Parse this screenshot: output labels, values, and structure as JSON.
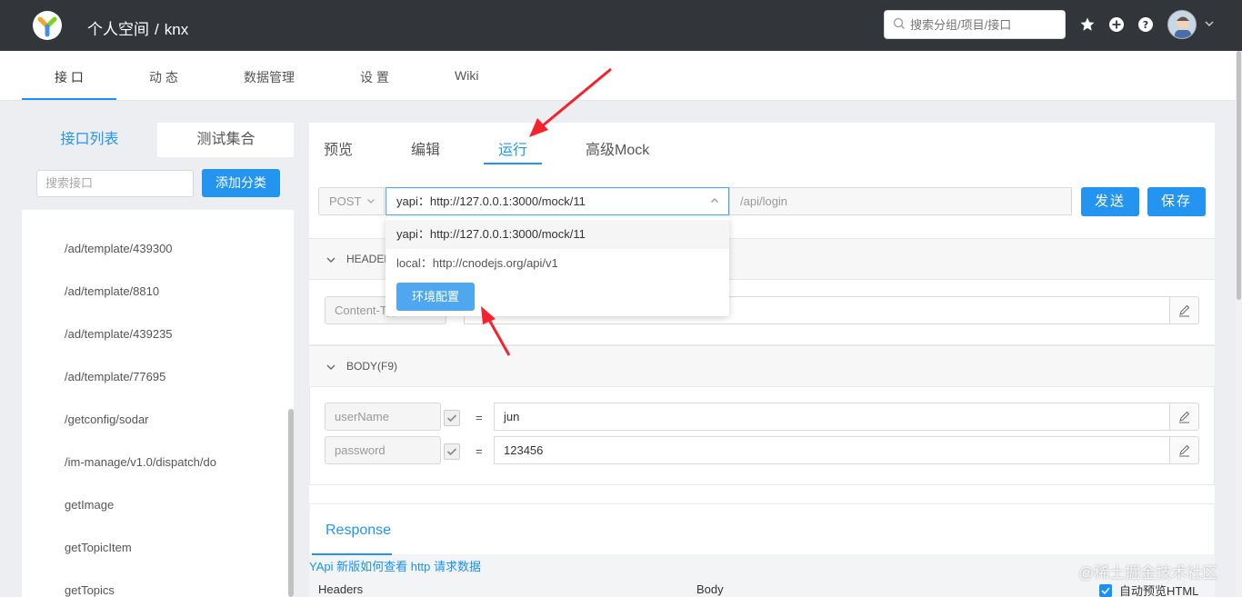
{
  "topbar": {
    "breadcrumb_space": "个人空间",
    "breadcrumb_sep": "/",
    "breadcrumb_project": "knx",
    "search_placeholder": "搜索分组/项目/接口",
    "icons": [
      "star-icon",
      "plus-circle-icon",
      "help-icon"
    ]
  },
  "subnav": {
    "tabs": [
      "接 口",
      "动 态",
      "数据管理",
      "设 置",
      "Wiki"
    ],
    "active": 0
  },
  "sidebar": {
    "tab_list": "接口列表",
    "tab_collection": "测试集合",
    "search_placeholder": "搜索接口",
    "add_category": "添加分类",
    "items": [
      "/ad/template/439300",
      "/ad/template/8810",
      "/ad/template/439235",
      "/ad/template/77695",
      "/getconfig/sodar",
      "/im-manage/v1.0/dispatch/do",
      "getImage",
      "getTopicItem",
      "getTopics"
    ]
  },
  "main": {
    "tabs": [
      "预览",
      "编辑",
      "运行",
      "高级Mock"
    ],
    "active_tab": 2,
    "method": "POST",
    "env_selected": "yapi：http://127.0.0.1:3000/mock/11",
    "path": "/api/login",
    "send_label": "发送",
    "save_label": "保存",
    "headers_label": "HEADERS",
    "header_key": "Content-Type",
    "body_label": "BODY(F9)",
    "body_params": [
      {
        "key": "userName",
        "value": "jun"
      },
      {
        "key": "password",
        "value": "123456"
      }
    ],
    "eq": "=",
    "response_title": "Response",
    "response_link": "YApi 新版如何查看 http 请求数据",
    "response_headers": "Headers",
    "response_body": "Body",
    "auto_preview": "自动预览HTML"
  },
  "env_dropdown": {
    "options": [
      "yapi：http://127.0.0.1:3000/mock/11",
      "local：http://cnodejs.org/api/v1"
    ],
    "config_button": "环境配置"
  },
  "watermark": "@稀土掘金技术社区",
  "colors": {
    "accent": "#2395f1",
    "topbar": "#32363a",
    "arrow": "#f5222d"
  }
}
